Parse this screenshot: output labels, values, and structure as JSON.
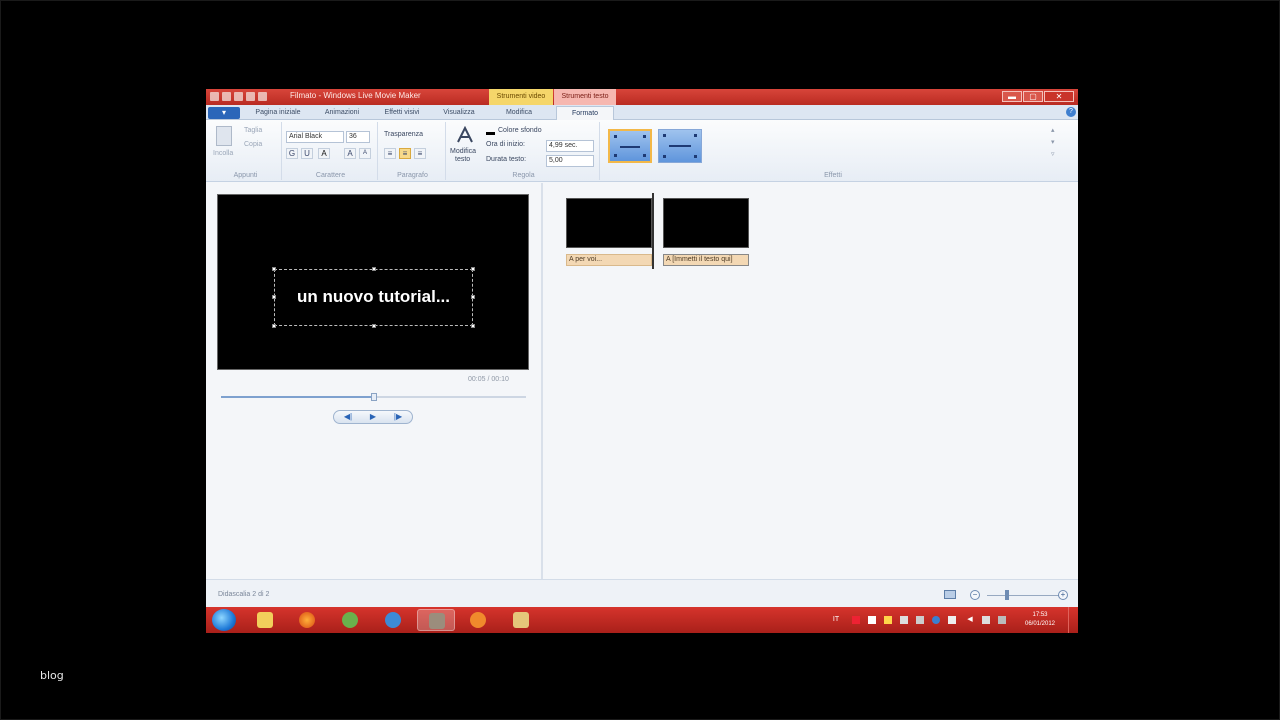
{
  "outer": {
    "footer_label": "blog"
  },
  "titlebar": {
    "title": "Filmato - Windows Live Movie Maker",
    "contextual_tabs": [
      "Strumenti video",
      "Strumenti testo"
    ],
    "buttons": {
      "minimize": "▬",
      "maximize": "▢",
      "close": "✕"
    }
  },
  "tabs": {
    "file": "▾",
    "items": [
      "Pagina iniziale",
      "Animazioni",
      "Effetti visivi",
      "Visualizza",
      "Modifica",
      "Formato"
    ],
    "active": "Formato"
  },
  "ribbon": {
    "clipboard": {
      "paste": "Incolla",
      "cut": "Taglia",
      "copy": "Copia",
      "label": "Appunti"
    },
    "font": {
      "family": "Arial Black",
      "size": "36",
      "bold": "G",
      "underline": "U",
      "color": "A",
      "grow": "A",
      "shrink": "A",
      "label": "Carattere"
    },
    "paragraph": {
      "transparency": "Trasparenza",
      "label": "Paragrafo"
    },
    "adjust": {
      "edit_text_line1": "Modifica",
      "edit_text_line2": "testo",
      "bg_color": "Colore sfondo",
      "start_time_label": "Ora di inizio:",
      "start_time_value": "4,99 sec.",
      "duration_label": "Durata testo:",
      "duration_value": "5,00",
      "label": "Regola"
    },
    "effects": {
      "label": "Effetti"
    }
  },
  "preview": {
    "caption": "un nuovo tutorial...",
    "timecode": "00:05 / 00:10",
    "progress": 0.5,
    "controls": {
      "prev": "◀|",
      "play": "▶",
      "next": "|▶"
    }
  },
  "storyboard": {
    "clips": [
      {
        "caption": "A  per voi..."
      },
      {
        "caption": "A  [Immetti il testo qui]"
      }
    ]
  },
  "status": {
    "text": "Didascalia 2 di 2",
    "zoom_out": "−",
    "zoom_in": "+"
  },
  "taskbar": {
    "clock_time": "17:53",
    "clock_date": "06/01/2012",
    "lang": "IT"
  }
}
